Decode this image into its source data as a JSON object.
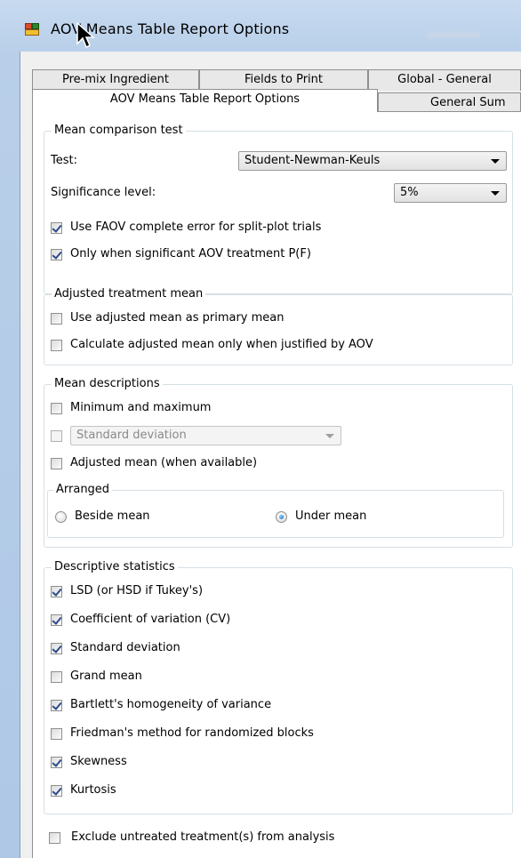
{
  "window": {
    "title": "AOV Means Table Report Options"
  },
  "tabs": {
    "row1": [
      "Pre-mix Ingredient",
      "Fields to Print",
      "Global - General"
    ],
    "row2": [
      "AOV Means Table Report Options",
      "General Sum"
    ]
  },
  "mean_comparison": {
    "title": "Mean comparison test",
    "test_label": "Test:",
    "test_value": "Student-Newman-Keuls",
    "significance_label": "Significance level:",
    "significance_value": "5%",
    "faov_label": "Use FAOV complete error for split-plot trials",
    "faov_checked": true,
    "only_sig_label": "Only when significant AOV treatment P(F)",
    "only_sig_checked": true
  },
  "adjusted": {
    "title": "Adjusted treatment mean",
    "primary_label": "Use adjusted mean as primary mean",
    "primary_checked": false,
    "justified_label": "Calculate adjusted mean only when justified by AOV",
    "justified_checked": false
  },
  "descriptions": {
    "title": "Mean descriptions",
    "minmax_label": "Minimum and maximum",
    "std_combo_value": "Standard deviation",
    "adjusted_label": "Adjusted mean (when available)",
    "arranged_title": "Arranged",
    "beside_label": "Beside mean",
    "under_label": "Under mean",
    "arranged_selected": "under"
  },
  "stats": {
    "title": "Descriptive statistics",
    "items": [
      {
        "label": "LSD (or HSD if Tukey's)",
        "checked": true
      },
      {
        "label": "Coefficient of variation (CV)",
        "checked": true
      },
      {
        "label": "Standard deviation",
        "checked": true
      },
      {
        "label": "Grand mean",
        "checked": false
      },
      {
        "label": "Bartlett's homogeneity of variance",
        "checked": true
      },
      {
        "label": "Friedman's method for randomized blocks",
        "checked": false
      },
      {
        "label": "Skewness",
        "checked": true
      },
      {
        "label": "Kurtosis",
        "checked": true
      }
    ]
  },
  "exclude": {
    "label": "Exclude untreated treatment(s) from analysis",
    "checked": false
  }
}
